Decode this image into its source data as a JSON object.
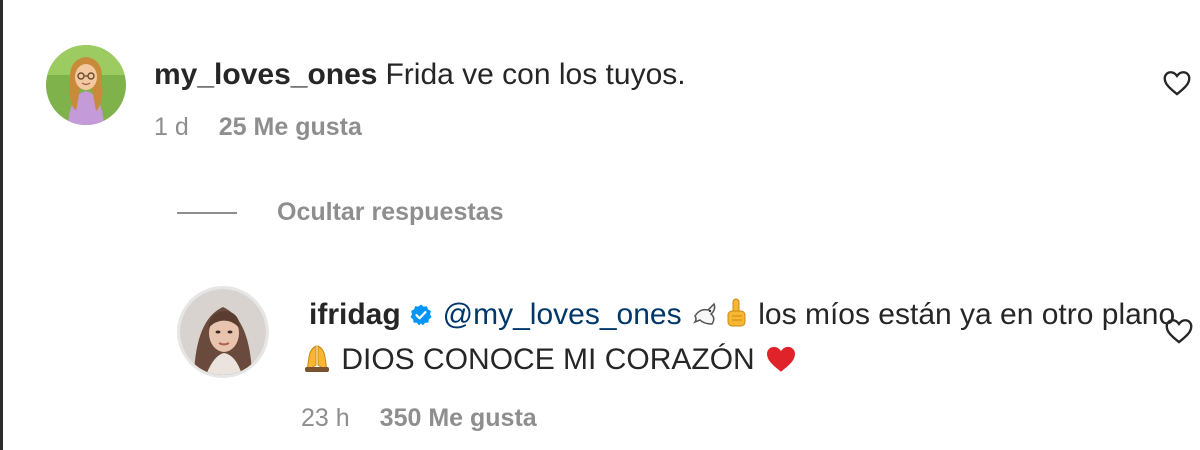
{
  "comment1": {
    "username": "my_loves_ones",
    "text": "Frida ve con los tuyos.",
    "time": "1 d",
    "likes": "25 Me gusta"
  },
  "replies_toggle": {
    "label": "Ocultar respuestas"
  },
  "comment2": {
    "username": "ifridag",
    "mention": "@my_loves_ones",
    "text_part1": "los míos están ya en otro plano",
    "text_part2": "DIOS CONOCE MI CORAZÓN",
    "time": "23 h",
    "likes": "350 Me gusta"
  },
  "icons": {
    "verified": "verified-badge-icon",
    "like": "heart-outline-icon",
    "emojis": [
      "dove-icon",
      "pointing-up-icon",
      "praying-hands-icon",
      "red-heart-icon"
    ]
  },
  "colors": {
    "text": "#262626",
    "secondary": "#8e8e8e",
    "mention": "#00376b",
    "verified": "#0095f6",
    "heart": "#e0222a"
  }
}
